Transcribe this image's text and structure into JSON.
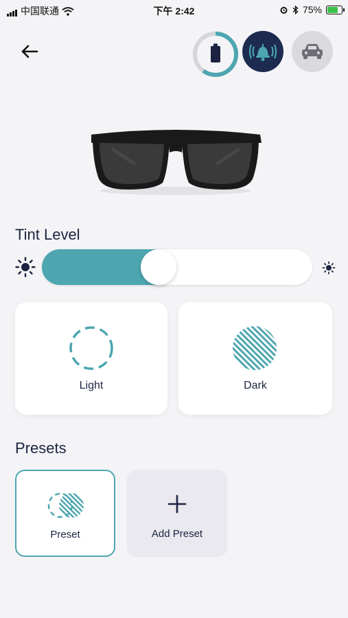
{
  "status_bar": {
    "carrier": "中国联通",
    "time": "下午 2:42",
    "battery_pct": "75%"
  },
  "header": {
    "back_icon": "arrow-left-icon",
    "buttons": [
      {
        "name": "battery",
        "icon": "battery-icon",
        "level": 0.6
      },
      {
        "name": "alert",
        "icon": "bell-icon"
      },
      {
        "name": "car",
        "icon": "car-icon"
      }
    ]
  },
  "product": {
    "image": "sunglasses"
  },
  "tint": {
    "title": "Tint Level",
    "level": 0.42,
    "accent": "#4da6b0"
  },
  "modes": [
    {
      "label": "Light",
      "icon": "dashed-circle-icon"
    },
    {
      "label": "Dark",
      "icon": "hatched-circle-icon"
    }
  ],
  "presets": {
    "title": "Presets",
    "items": [
      {
        "label": "Preset",
        "icon": "preset-icon",
        "selected": true
      },
      {
        "label": "Add Preset",
        "icon": "plus-icon",
        "selected": false
      }
    ]
  }
}
